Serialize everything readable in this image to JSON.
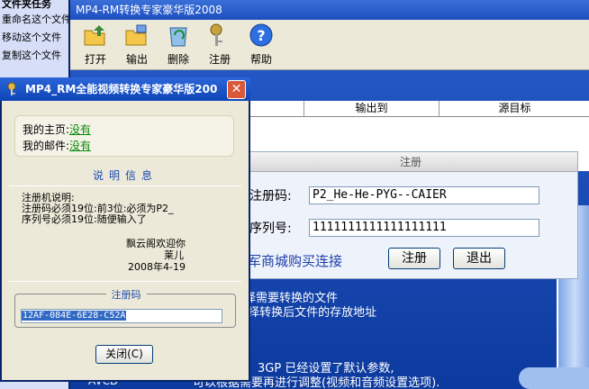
{
  "explorer": {
    "header": "文件夹任务",
    "items": [
      "重命名这个文件",
      "移动这个文件",
      "复制这个文件"
    ]
  },
  "main_window": {
    "title": "MP4-RM转换专家豪华版2008",
    "toolbar": [
      {
        "label": "打开",
        "icon": "open-folder-icon"
      },
      {
        "label": "输出",
        "icon": "output-folder-icon"
      },
      {
        "label": "删除",
        "icon": "recycle-bin-icon"
      },
      {
        "label": "注册",
        "icon": "key-icon"
      },
      {
        "label": "帮助",
        "icon": "help-icon"
      }
    ],
    "columns": [
      "",
      "",
      "输出到",
      "源目标"
    ],
    "steps_1": [
      "选择需要转换的文件",
      ",选择转换后文件的存放地址"
    ],
    "steps_2": [
      "3GP 已经设置了默认参数,",
      "可以根据需要再进行调整(视频和音频设置选项)."
    ],
    "bottom_left": "AVCD"
  },
  "register_panel": {
    "title": "注册",
    "code_label": "注册码:",
    "code_value": "P2_He-He-PYG--CAIER",
    "serial_label": "序列号:",
    "serial_value": "1111111111111111111",
    "link": "军商城购买连接",
    "register_button": "注册",
    "exit_button": "退出"
  },
  "about_dialog": {
    "title": "MP4_RM全能视频转换专家豪华版200",
    "homepage_label": "我的主页:",
    "homepage_value": "没有",
    "email_label": "我的邮件:",
    "email_value": "没有",
    "section_title": "说明信息",
    "desc": [
      "注册机说明:",
      "注册码必须19位:前3位:必须为P2_",
      "序列号必须19位:随便输入了"
    ],
    "signature": [
      "飘云阁欢迎你",
      "莱儿",
      "2008年4-19"
    ],
    "code_group_title": "注册码",
    "generated_code": "12AF-084E-6E28-C52A",
    "close_button": "关闭(C)"
  }
}
